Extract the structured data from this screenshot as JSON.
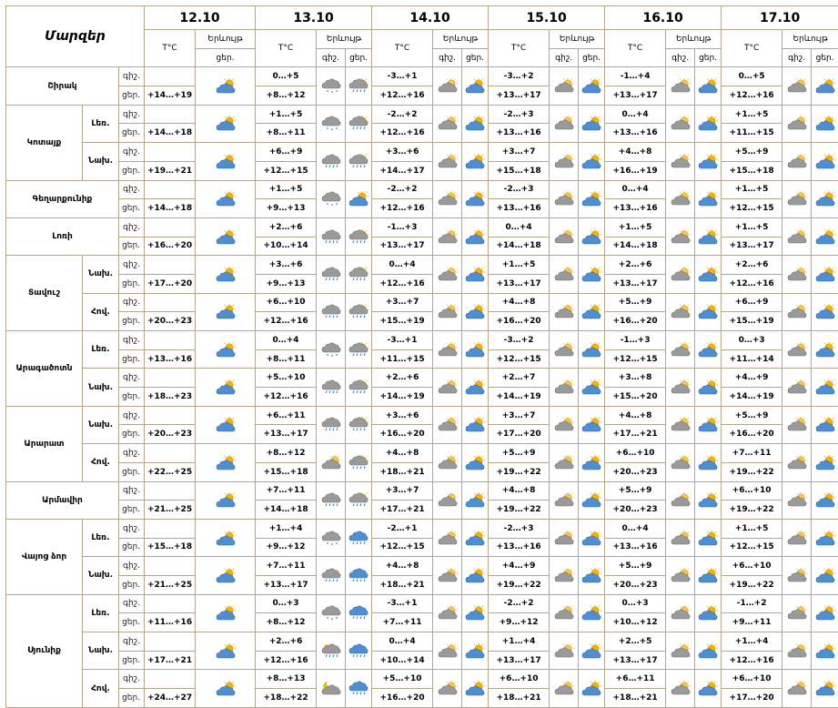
{
  "header": {
    "title": "Մարզեր",
    "temp_label": "T°C",
    "weather_label": "Երևույթ",
    "day_label": "ցեր.",
    "night_label": "գիշ."
  },
  "dates": [
    "12.10",
    "13.10",
    "14.10",
    "15.10",
    "16.10",
    "17.10"
  ],
  "regions": [
    {
      "name": "Շիրակ",
      "parts": [
        {
          "part": "",
          "first": {
            "tod": "գիշ.",
            "t": [
              "",
              "0…+5",
              "-3…+1",
              "-3…+2",
              "-1…+4",
              "0…+5"
            ]
          },
          "second": {
            "tod": "ցեր.",
            "t": [
              "+14…+19",
              "+8…+12",
              "+12…+16",
              "+13…+17",
              "+13…+17",
              "+12…+16"
            ]
          },
          "icons": {
            "d1": "partly-sunny-icon",
            "n": [
              "rain-snow-cloud-icon",
              "cloudy-icon",
              "cloudy-icon",
              "cloudy-icon",
              "cloudy-icon"
            ],
            "d": [
              "sun-rain-icon",
              "partly-sunny-icon",
              "partly-sunny-icon",
              "partly-sunny-icon",
              "partly-sunny-icon"
            ]
          }
        }
      ]
    },
    {
      "name": "Կոտայք",
      "parts": [
        {
          "part": "Լեռ.",
          "first": {
            "tod": "գիշ.",
            "t": [
              "",
              "+1…+5",
              "-2…+2",
              "-2…+3",
              "0…+4",
              "+1…+5"
            ]
          },
          "second": {
            "tod": "ցեր.",
            "t": [
              "+14…+18",
              "+8…+11",
              "+12…+16",
              "+13…+16",
              "+13…+16",
              "+11…+15"
            ]
          },
          "icons": {
            "d1": "partly-sunny-icon",
            "n": [
              "rain-snow-cloud-icon",
              "cloudy-icon",
              "cloudy-icon",
              "cloudy-icon",
              "cloudy-icon"
            ],
            "d": [
              "sun-rain-icon",
              "partly-sunny-icon",
              "partly-sunny-icon",
              "partly-sunny-icon",
              "partly-sunny-icon"
            ]
          }
        },
        {
          "part": "Նախ.",
          "first": {
            "tod": "գիշ.",
            "t": [
              "",
              "+6…+9",
              "+3…+6",
              "+3…+7",
              "+4…+8",
              "+5…+9"
            ]
          },
          "second": {
            "tod": "ցեր.",
            "t": [
              "+19…+21",
              "+12…+15",
              "+14…+17",
              "+15…+18",
              "+16…+19",
              "+15…+18"
            ]
          },
          "icons": {
            "d1": "partly-sunny-icon",
            "n": [
              "rain-cloud-icon",
              "cloudy-icon",
              "cloudy-icon",
              "cloudy-icon",
              "cloudy-icon"
            ],
            "d": [
              "sun-rain-icon",
              "partly-sunny-icon",
              "partly-sunny-icon",
              "partly-sunny-icon",
              "partly-sunny-icon"
            ]
          }
        }
      ]
    },
    {
      "name": "Գեղարքունիք",
      "parts": [
        {
          "part": "",
          "first": {
            "tod": "գիշ.",
            "t": [
              "",
              "+1…+5",
              "-2…+2",
              "-2…+3",
              "0…+4",
              "+1…+5"
            ]
          },
          "second": {
            "tod": "ցեր.",
            "t": [
              "+14…+18",
              "+9…+13",
              "+12…+16",
              "+13…+16",
              "+13…+16",
              "+12…+15"
            ]
          },
          "icons": {
            "d1": "partly-sunny-icon",
            "n": [
              "rain-snow-cloud-icon",
              "cloudy-icon",
              "cloudy-icon",
              "cloudy-icon",
              "cloudy-icon"
            ],
            "d": [
              "partly-sunny-icon",
              "partly-sunny-icon",
              "partly-sunny-icon",
              "partly-sunny-icon",
              "partly-sunny-icon"
            ]
          }
        }
      ]
    },
    {
      "name": "Լոռի",
      "parts": [
        {
          "part": "",
          "first": {
            "tod": "գիշ.",
            "t": [
              "",
              "+2…+6",
              "-1…+3",
              "0…+4",
              "+1…+5",
              "+1…+5"
            ]
          },
          "second": {
            "tod": "ցեր.",
            "t": [
              "+16…+20",
              "+10…+14",
              "+13…+17",
              "+14…+18",
              "+14…+18",
              "+13…+17"
            ]
          },
          "icons": {
            "d1": "partly-sunny-icon",
            "n": [
              "rain-cloud-icon",
              "cloudy-icon",
              "cloudy-icon",
              "cloudy-icon",
              "cloudy-icon"
            ],
            "d": [
              "sun-rain-icon",
              "partly-sunny-icon",
              "partly-sunny-icon",
              "partly-sunny-icon",
              "partly-sunny-icon"
            ]
          }
        }
      ]
    },
    {
      "name": "Տավուշ",
      "parts": [
        {
          "part": "Նախ.",
          "first": {
            "tod": "գիշ.",
            "t": [
              "",
              "+3…+6",
              "0…+4",
              "+1…+5",
              "+2…+6",
              "+2…+6"
            ]
          },
          "second": {
            "tod": "ցեր.",
            "t": [
              "+17…+20",
              "+9…+13",
              "+12…+16",
              "+13…+17",
              "+13…+17",
              "+12…+16"
            ]
          },
          "icons": {
            "d1": "partly-sunny-icon",
            "n": [
              "rain-cloud-icon",
              "cloudy-icon",
              "cloudy-icon",
              "cloudy-icon",
              "cloudy-icon"
            ],
            "d": [
              "sun-rain-icon",
              "partly-sunny-icon",
              "partly-sunny-icon",
              "partly-sunny-icon",
              "partly-sunny-icon"
            ]
          }
        },
        {
          "part": "Հով.",
          "first": {
            "tod": "գիշ.",
            "t": [
              "",
              "+6…+10",
              "+3…+7",
              "+4…+8",
              "+5…+9",
              "+6…+9"
            ]
          },
          "second": {
            "tod": "ցեր.",
            "t": [
              "+20…+23",
              "+12…+16",
              "+15…+19",
              "+16…+20",
              "+16…+20",
              "+15…+19"
            ]
          },
          "icons": {
            "d1": "partly-sunny-icon",
            "n": [
              "rain-cloud-icon",
              "cloudy-icon",
              "cloudy-icon",
              "cloudy-icon",
              "cloudy-icon"
            ],
            "d": [
              "sun-rain-icon",
              "partly-sunny-icon",
              "partly-sunny-icon",
              "partly-sunny-icon",
              "partly-sunny-icon"
            ]
          }
        }
      ]
    },
    {
      "name": "Արագածոտն",
      "parts": [
        {
          "part": "Լեռ.",
          "first": {
            "tod": "գիշ.",
            "t": [
              "",
              "0…+4",
              "-3…+1",
              "-3…+2",
              "-1…+3",
              "0…+3"
            ]
          },
          "second": {
            "tod": "ցեր.",
            "t": [
              "+13…+16",
              "+8…+11",
              "+11…+15",
              "+12…+15",
              "+12…+15",
              "+11…+14"
            ]
          },
          "icons": {
            "d1": "partly-sunny-icon",
            "n": [
              "rain-snow-cloud-icon",
              "cloudy-icon",
              "cloudy-icon",
              "cloudy-icon",
              "cloudy-icon"
            ],
            "d": [
              "sun-rain-icon",
              "partly-sunny-icon",
              "partly-sunny-icon",
              "partly-sunny-icon",
              "partly-sunny-icon"
            ]
          }
        },
        {
          "part": "Նախ.",
          "first": {
            "tod": "գիշ.",
            "t": [
              "",
              "+5…+10",
              "+2…+6",
              "+2…+7",
              "+3…+8",
              "+4…+9"
            ]
          },
          "second": {
            "tod": "ցեր.",
            "t": [
              "+18…+23",
              "+12…+16",
              "+14…+19",
              "+14…+19",
              "+15…+20",
              "+14…+19"
            ]
          },
          "icons": {
            "d1": "partly-sunny-icon",
            "n": [
              "rain-cloud-icon",
              "cloudy-icon",
              "cloudy-icon",
              "cloudy-icon",
              "cloudy-icon"
            ],
            "d": [
              "sun-rain-icon",
              "partly-sunny-icon",
              "partly-sunny-icon",
              "partly-sunny-icon",
              "partly-sunny-icon"
            ]
          }
        }
      ]
    },
    {
      "name": "Արարատ",
      "parts": [
        {
          "part": "Նախ.",
          "first": {
            "tod": "գիշ.",
            "t": [
              "",
              "+6…+11",
              "+3…+6",
              "+3…+7",
              "+4…+8",
              "+5…+9"
            ]
          },
          "second": {
            "tod": "ցեր.",
            "t": [
              "+20…+23",
              "+13…+17",
              "+16…+20",
              "+17…+20",
              "+17…+21",
              "+16…+20"
            ]
          },
          "icons": {
            "d1": "partly-sunny-icon",
            "n": [
              "rain-cloud-icon",
              "cloudy-icon",
              "cloudy-icon",
              "cloudy-icon",
              "cloudy-icon"
            ],
            "d": [
              "sun-rain-icon",
              "partly-sunny-icon",
              "partly-sunny-icon",
              "partly-sunny-icon",
              "partly-sunny-icon"
            ]
          }
        },
        {
          "part": "Հով.",
          "first": {
            "tod": "գիշ.",
            "t": [
              "",
              "+8…+12",
              "+4…+8",
              "+5…+9",
              "+6…+10",
              "+7…+11"
            ]
          },
          "second": {
            "tod": "ցեր.",
            "t": [
              "+22…+25",
              "+15…+18",
              "+18…+21",
              "+19…+22",
              "+20…+23",
              "+19…+22"
            ]
          },
          "icons": {
            "d1": "partly-sunny-icon",
            "n": [
              "cloudy-icon",
              "cloudy-icon",
              "cloudy-icon",
              "cloudy-icon",
              "cloudy-icon"
            ],
            "d": [
              "sun-rain-icon",
              "partly-sunny-icon",
              "partly-sunny-icon",
              "partly-sunny-icon",
              "partly-sunny-icon"
            ]
          }
        }
      ]
    },
    {
      "name": "Արմավիր",
      "parts": [
        {
          "part": "",
          "first": {
            "tod": "գիշ.",
            "t": [
              "",
              "+7…+11",
              "+3…+7",
              "+4…+8",
              "+5…+9",
              "+6…+10"
            ]
          },
          "second": {
            "tod": "ցեր.",
            "t": [
              "+21…+25",
              "+14…+18",
              "+17…+21",
              "+19…+22",
              "+20…+23",
              "+19…+22"
            ]
          },
          "icons": {
            "d1": "partly-sunny-icon",
            "n": [
              "rain-cloud-icon",
              "cloudy-icon",
              "cloudy-icon",
              "cloudy-icon",
              "cloudy-icon"
            ],
            "d": [
              "sun-rain-icon",
              "partly-sunny-icon",
              "partly-sunny-icon",
              "partly-sunny-icon",
              "partly-sunny-icon"
            ]
          }
        }
      ]
    },
    {
      "name": "Վայոց ձոր",
      "parts": [
        {
          "part": "Լեռ.",
          "first": {
            "tod": "գիշ.",
            "t": [
              "",
              "+1…+4",
              "-2…+1",
              "-2…+3",
              "0…+4",
              "+1…+5"
            ]
          },
          "second": {
            "tod": "ցեր.",
            "t": [
              "+15…+18",
              "+9…+12",
              "+12…+15",
              "+13…+16",
              "+13…+16",
              "+12…+15"
            ]
          },
          "icons": {
            "d1": "partly-sunny-icon",
            "n": [
              "rain-snow-cloud-icon",
              "cloudy-icon",
              "cloudy-icon",
              "cloudy-icon",
              "cloudy-icon"
            ],
            "d": [
              "rain-cloud-blue-icon",
              "partly-sunny-icon",
              "partly-sunny-icon",
              "partly-sunny-icon",
              "partly-sunny-icon"
            ]
          }
        },
        {
          "part": "Նախ.",
          "first": {
            "tod": "գիշ.",
            "t": [
              "",
              "+7…+11",
              "+4…+8",
              "+4…+9",
              "+5…+9",
              "+6…+10"
            ]
          },
          "second": {
            "tod": "ցեր.",
            "t": [
              "+21…+25",
              "+13…+17",
              "+18…+21",
              "+19…+22",
              "+20…+23",
              "+19…+22"
            ]
          },
          "icons": {
            "d1": "partly-sunny-icon",
            "n": [
              "rain-cloud-icon",
              "cloudy-icon",
              "cloudy-icon",
              "cloudy-icon",
              "cloudy-icon"
            ],
            "d": [
              "rain-cloud-blue-icon",
              "partly-sunny-icon",
              "partly-sunny-icon",
              "partly-sunny-icon",
              "partly-sunny-icon"
            ]
          }
        }
      ]
    },
    {
      "name": "Սյունիք",
      "parts": [
        {
          "part": "Լեռ.",
          "first": {
            "tod": "գիշ.",
            "t": [
              "",
              "0…+3",
              "-3…+1",
              "-2…+2",
              "0…+3",
              "-1…+2"
            ]
          },
          "second": {
            "tod": "ցեր.",
            "t": [
              "+11…+16",
              "+8…+12",
              "+7…+11",
              "+9…+12",
              "+10…+12",
              "+9…+11"
            ]
          },
          "icons": {
            "d1": "partly-sunny-icon",
            "n": [
              "rain-snow-cloud-icon",
              "cloudy-icon",
              "cloudy-icon",
              "cloudy-icon",
              "cloudy-icon"
            ],
            "d": [
              "rain-cloud-blue-icon",
              "partly-sunny-icon",
              "partly-sunny-icon",
              "partly-sunny-icon",
              "partly-sunny-icon"
            ]
          }
        },
        {
          "part": "Նախ.",
          "first": {
            "tod": "գիշ.",
            "t": [
              "",
              "+2…+6",
              "0…+4",
              "+1…+4",
              "+2…+5",
              "+1…+4"
            ]
          },
          "second": {
            "tod": "ցեր.",
            "t": [
              "+17…+21",
              "+12…+16",
              "+10…+14",
              "+13…+17",
              "+13…+17",
              "+12…+16"
            ]
          },
          "icons": {
            "d1": "partly-sunny-icon",
            "n": [
              "moon-rain-icon",
              "cloudy-icon",
              "cloudy-icon",
              "cloudy-icon",
              "cloudy-icon"
            ],
            "d": [
              "rain-cloud-blue-icon",
              "partly-sunny-icon",
              "partly-sunny-icon",
              "partly-sunny-icon",
              "partly-sunny-icon"
            ]
          }
        },
        {
          "part": "Հով.",
          "first": {
            "tod": "գիշ.",
            "t": [
              "",
              "+8…+13",
              "+5…+10",
              "+6…+10",
              "+6…+11",
              "+6…+10"
            ]
          },
          "second": {
            "tod": "ցեր.",
            "t": [
              "+24…+27",
              "+18…+22",
              "+16…+20",
              "+18…+21",
              "+18…+21",
              "+17…+20"
            ]
          },
          "icons": {
            "d1": "partly-sunny-icon",
            "n": [
              "moon-cloud-icon",
              "cloudy-icon",
              "cloudy-icon",
              "cloudy-icon",
              "cloudy-icon"
            ],
            "d": [
              "rain-cloud-blue-icon",
              "partly-sunny-icon",
              "partly-sunny-icon",
              "partly-sunny-icon",
              "partly-sunny-icon"
            ]
          }
        }
      ]
    }
  ]
}
